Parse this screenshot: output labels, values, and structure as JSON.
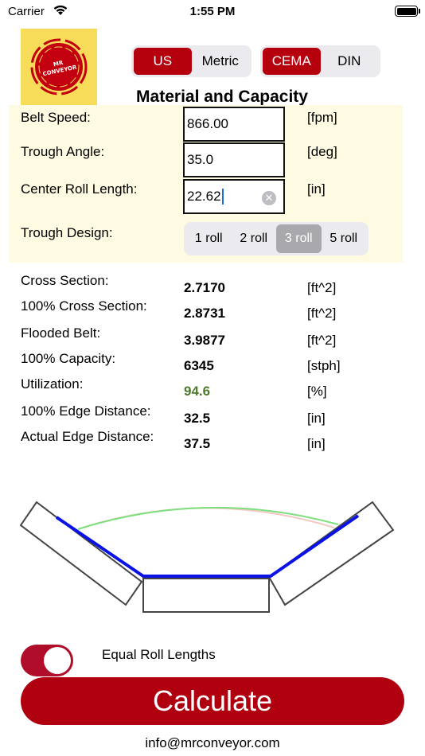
{
  "status_bar": {
    "carrier": "Carrier",
    "time": "1:55 PM"
  },
  "logo": {
    "line1": "MR",
    "line2": "CONVEYOR"
  },
  "units_toggle": {
    "options": [
      "US",
      "Metric"
    ],
    "selected": "US"
  },
  "standard_toggle": {
    "options": [
      "CEMA",
      "DIN"
    ],
    "selected": "CEMA"
  },
  "title": "Material and Capacity",
  "inputs": {
    "belt_speed": {
      "label": "Belt Speed:",
      "value": "866.00",
      "unit": "[fpm]"
    },
    "trough_angle": {
      "label": "Trough Angle:",
      "value": "35.0",
      "unit": "[deg]"
    },
    "center_roll_length": {
      "label": "Center Roll Length:",
      "value": "22.62",
      "unit": "[in]"
    }
  },
  "trough_design": {
    "label": "Trough Design:",
    "options": [
      "1 roll",
      "2 roll",
      "3 roll",
      "5 roll"
    ],
    "selected": "3 roll"
  },
  "results": [
    {
      "label": "Cross Section:",
      "value": "2.7170",
      "unit": "[ft^2]"
    },
    {
      "label": "100% Cross Section:",
      "value": "2.8731",
      "unit": "[ft^2]"
    },
    {
      "label": "Flooded Belt:",
      "value": "3.9877",
      "unit": "[ft^2]"
    },
    {
      "label": "100% Capacity:",
      "value": "6345",
      "unit": "[stph]"
    },
    {
      "label": "Utilization:",
      "value": "94.6",
      "unit": "[%]",
      "color": "#4e7a2c"
    },
    {
      "label": "100% Edge Distance:",
      "value": "32.5",
      "unit": "[in]"
    },
    {
      "label": "Actual Edge Distance:",
      "value": "37.5",
      "unit": "[in]"
    }
  ],
  "equal_roll_lengths": {
    "label": "Equal Roll Lengths",
    "on": true
  },
  "calculate_label": "Calculate",
  "email": "info@mrconveyor.com",
  "colors": {
    "accent": "#b5000d",
    "panel": "#fefbe2",
    "belt": "#0a12e6",
    "utilization": "#4e7a2c"
  }
}
